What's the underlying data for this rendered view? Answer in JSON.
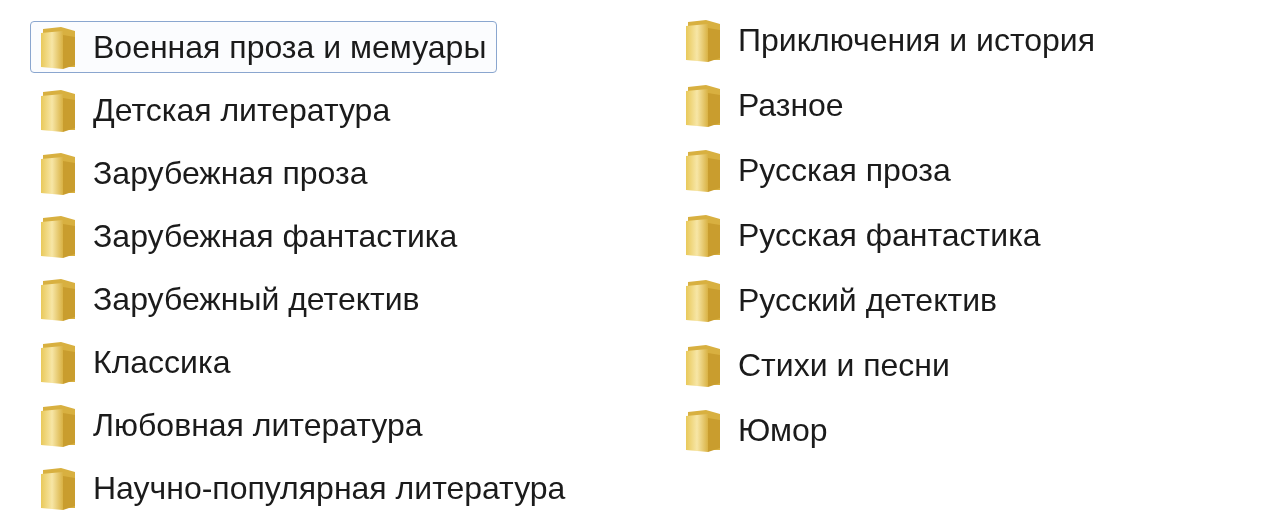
{
  "columns": [
    {
      "items": [
        {
          "label": "Военная проза и мемуары",
          "selected": true
        },
        {
          "label": "Детская литература",
          "selected": false
        },
        {
          "label": "Зарубежная проза",
          "selected": false
        },
        {
          "label": "Зарубежная фантастика",
          "selected": false
        },
        {
          "label": "Зарубежный детектив",
          "selected": false
        },
        {
          "label": "Классика",
          "selected": false
        },
        {
          "label": "Любовная литература",
          "selected": false
        },
        {
          "label": "Научно-популярная литература",
          "selected": false
        }
      ]
    },
    {
      "items": [
        {
          "label": "Приключения и история",
          "selected": false
        },
        {
          "label": "Разное",
          "selected": false
        },
        {
          "label": "Русская проза",
          "selected": false
        },
        {
          "label": "Русская фантастика",
          "selected": false
        },
        {
          "label": "Русский детектив",
          "selected": false
        },
        {
          "label": "Стихи и песни",
          "selected": false
        },
        {
          "label": "Юмор",
          "selected": false
        }
      ]
    }
  ]
}
